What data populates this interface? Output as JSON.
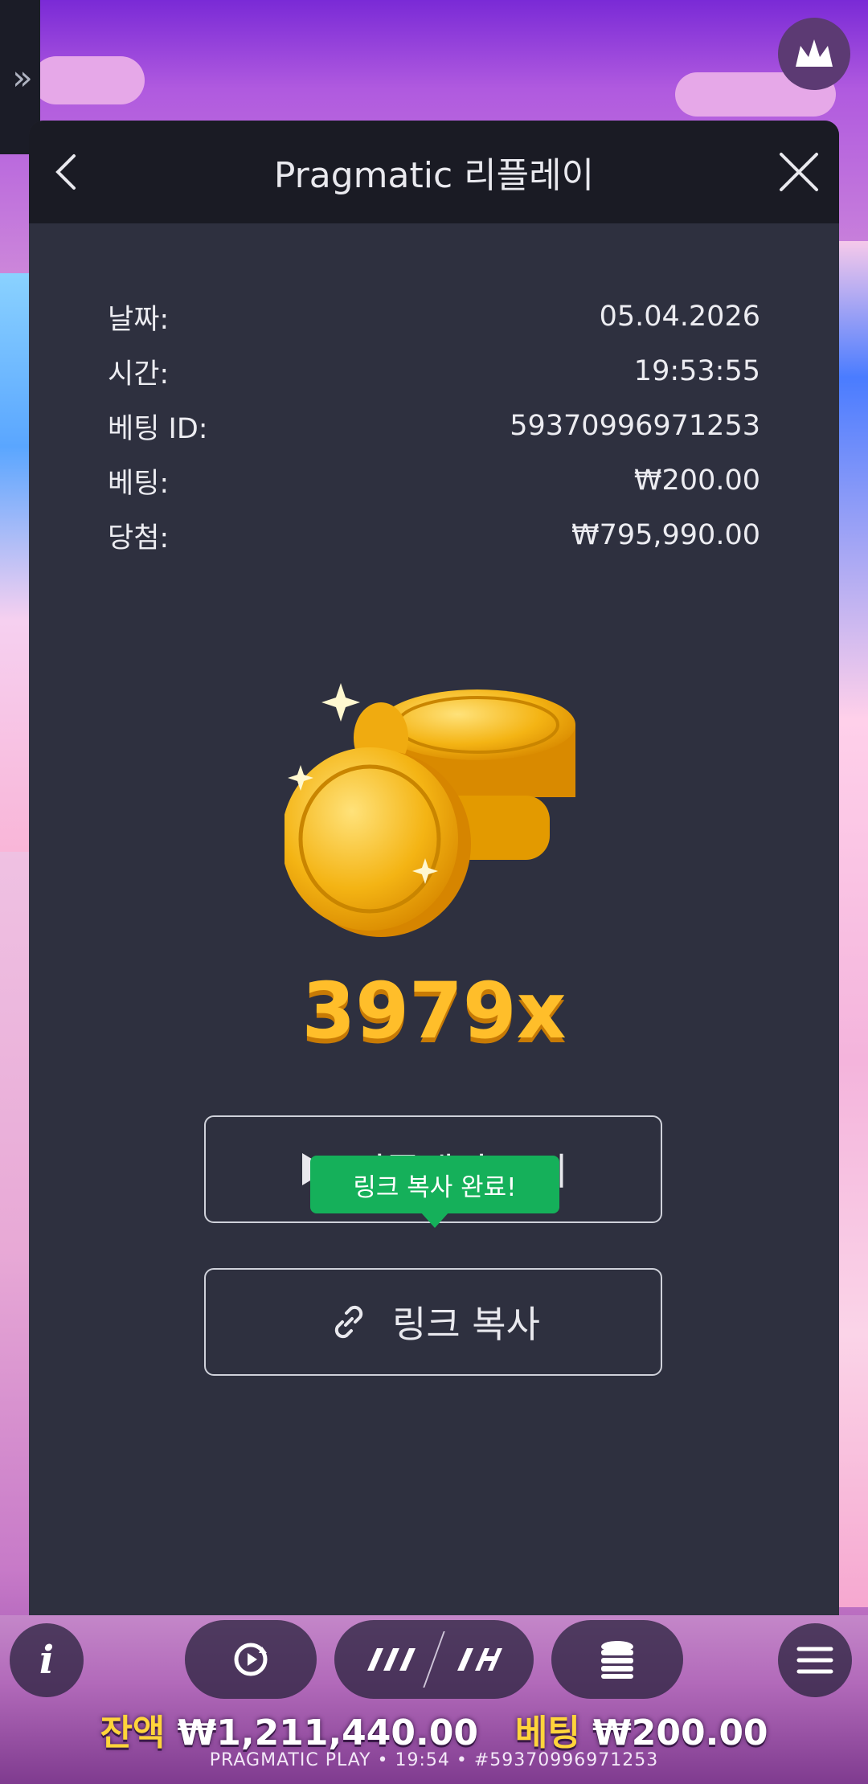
{
  "modal": {
    "title": "Pragmatic 리플레이",
    "info": [
      {
        "label": "날짜:",
        "value": "05.04.2026"
      },
      {
        "label": "시간:",
        "value": "19:53:55"
      },
      {
        "label": "베팅 ID:",
        "value": "59370996971253"
      },
      {
        "label": "베팅:",
        "value": "₩200.00"
      },
      {
        "label": "당첨:",
        "value": "₩795,990.00"
      }
    ],
    "multiplier": "3979x",
    "replay_button": "리플레이 보기",
    "copy_link_button": "링크 복사",
    "toast": "링크 복사 완료!"
  },
  "bottom_bar": {
    "balance_label": "잔액",
    "balance_value": "₩1,211,440.00",
    "bet_label": "베팅",
    "bet_value": "₩200.00",
    "footer": "PRAGMATIC PLAY • 19:54 • #59370996971253"
  },
  "colors": {
    "modal_bg": "#2e303f",
    "header_bg": "#1a1b24",
    "toast_green": "#15b05a",
    "multiplier_gold": "#ffbe2a",
    "balance_yellow": "#ffd43b"
  },
  "icons": [
    "expand-sidebar-icon",
    "crown-logo-icon",
    "back-icon",
    "close-icon",
    "play-icon",
    "link-icon",
    "info-icon",
    "autoplay-icon",
    "turbo-icon",
    "hyper-icon",
    "coins-icon",
    "menu-icon"
  ]
}
